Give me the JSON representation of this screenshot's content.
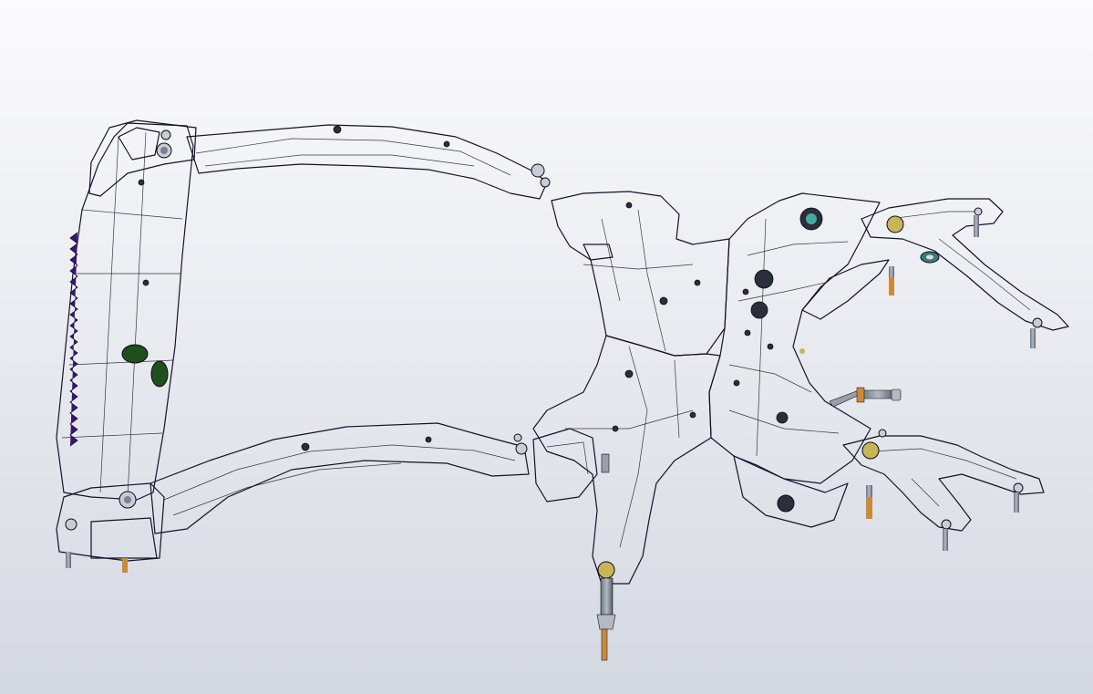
{
  "viewport": {
    "background_top": "#fbfbfd",
    "background_bottom": "#d4d8e1"
  },
  "model": {
    "colors": {
      "purple": "#4c1f8f",
      "purple_dark": "#34136a",
      "green": "#1f4f1c",
      "green_dark": "#14350f",
      "teal": "#2a8c86",
      "teal_dark": "#1c625e",
      "blue": "#2a5ea8",
      "blue_dark": "#1b3f78",
      "gray": "#8f8ea4",
      "gray_dark": "#5e5d73",
      "bolt_gold": "#c9b45a",
      "stud_orange": "#c98a3a"
    },
    "icons": [
      "bolt-icon",
      "stud-icon"
    ]
  }
}
